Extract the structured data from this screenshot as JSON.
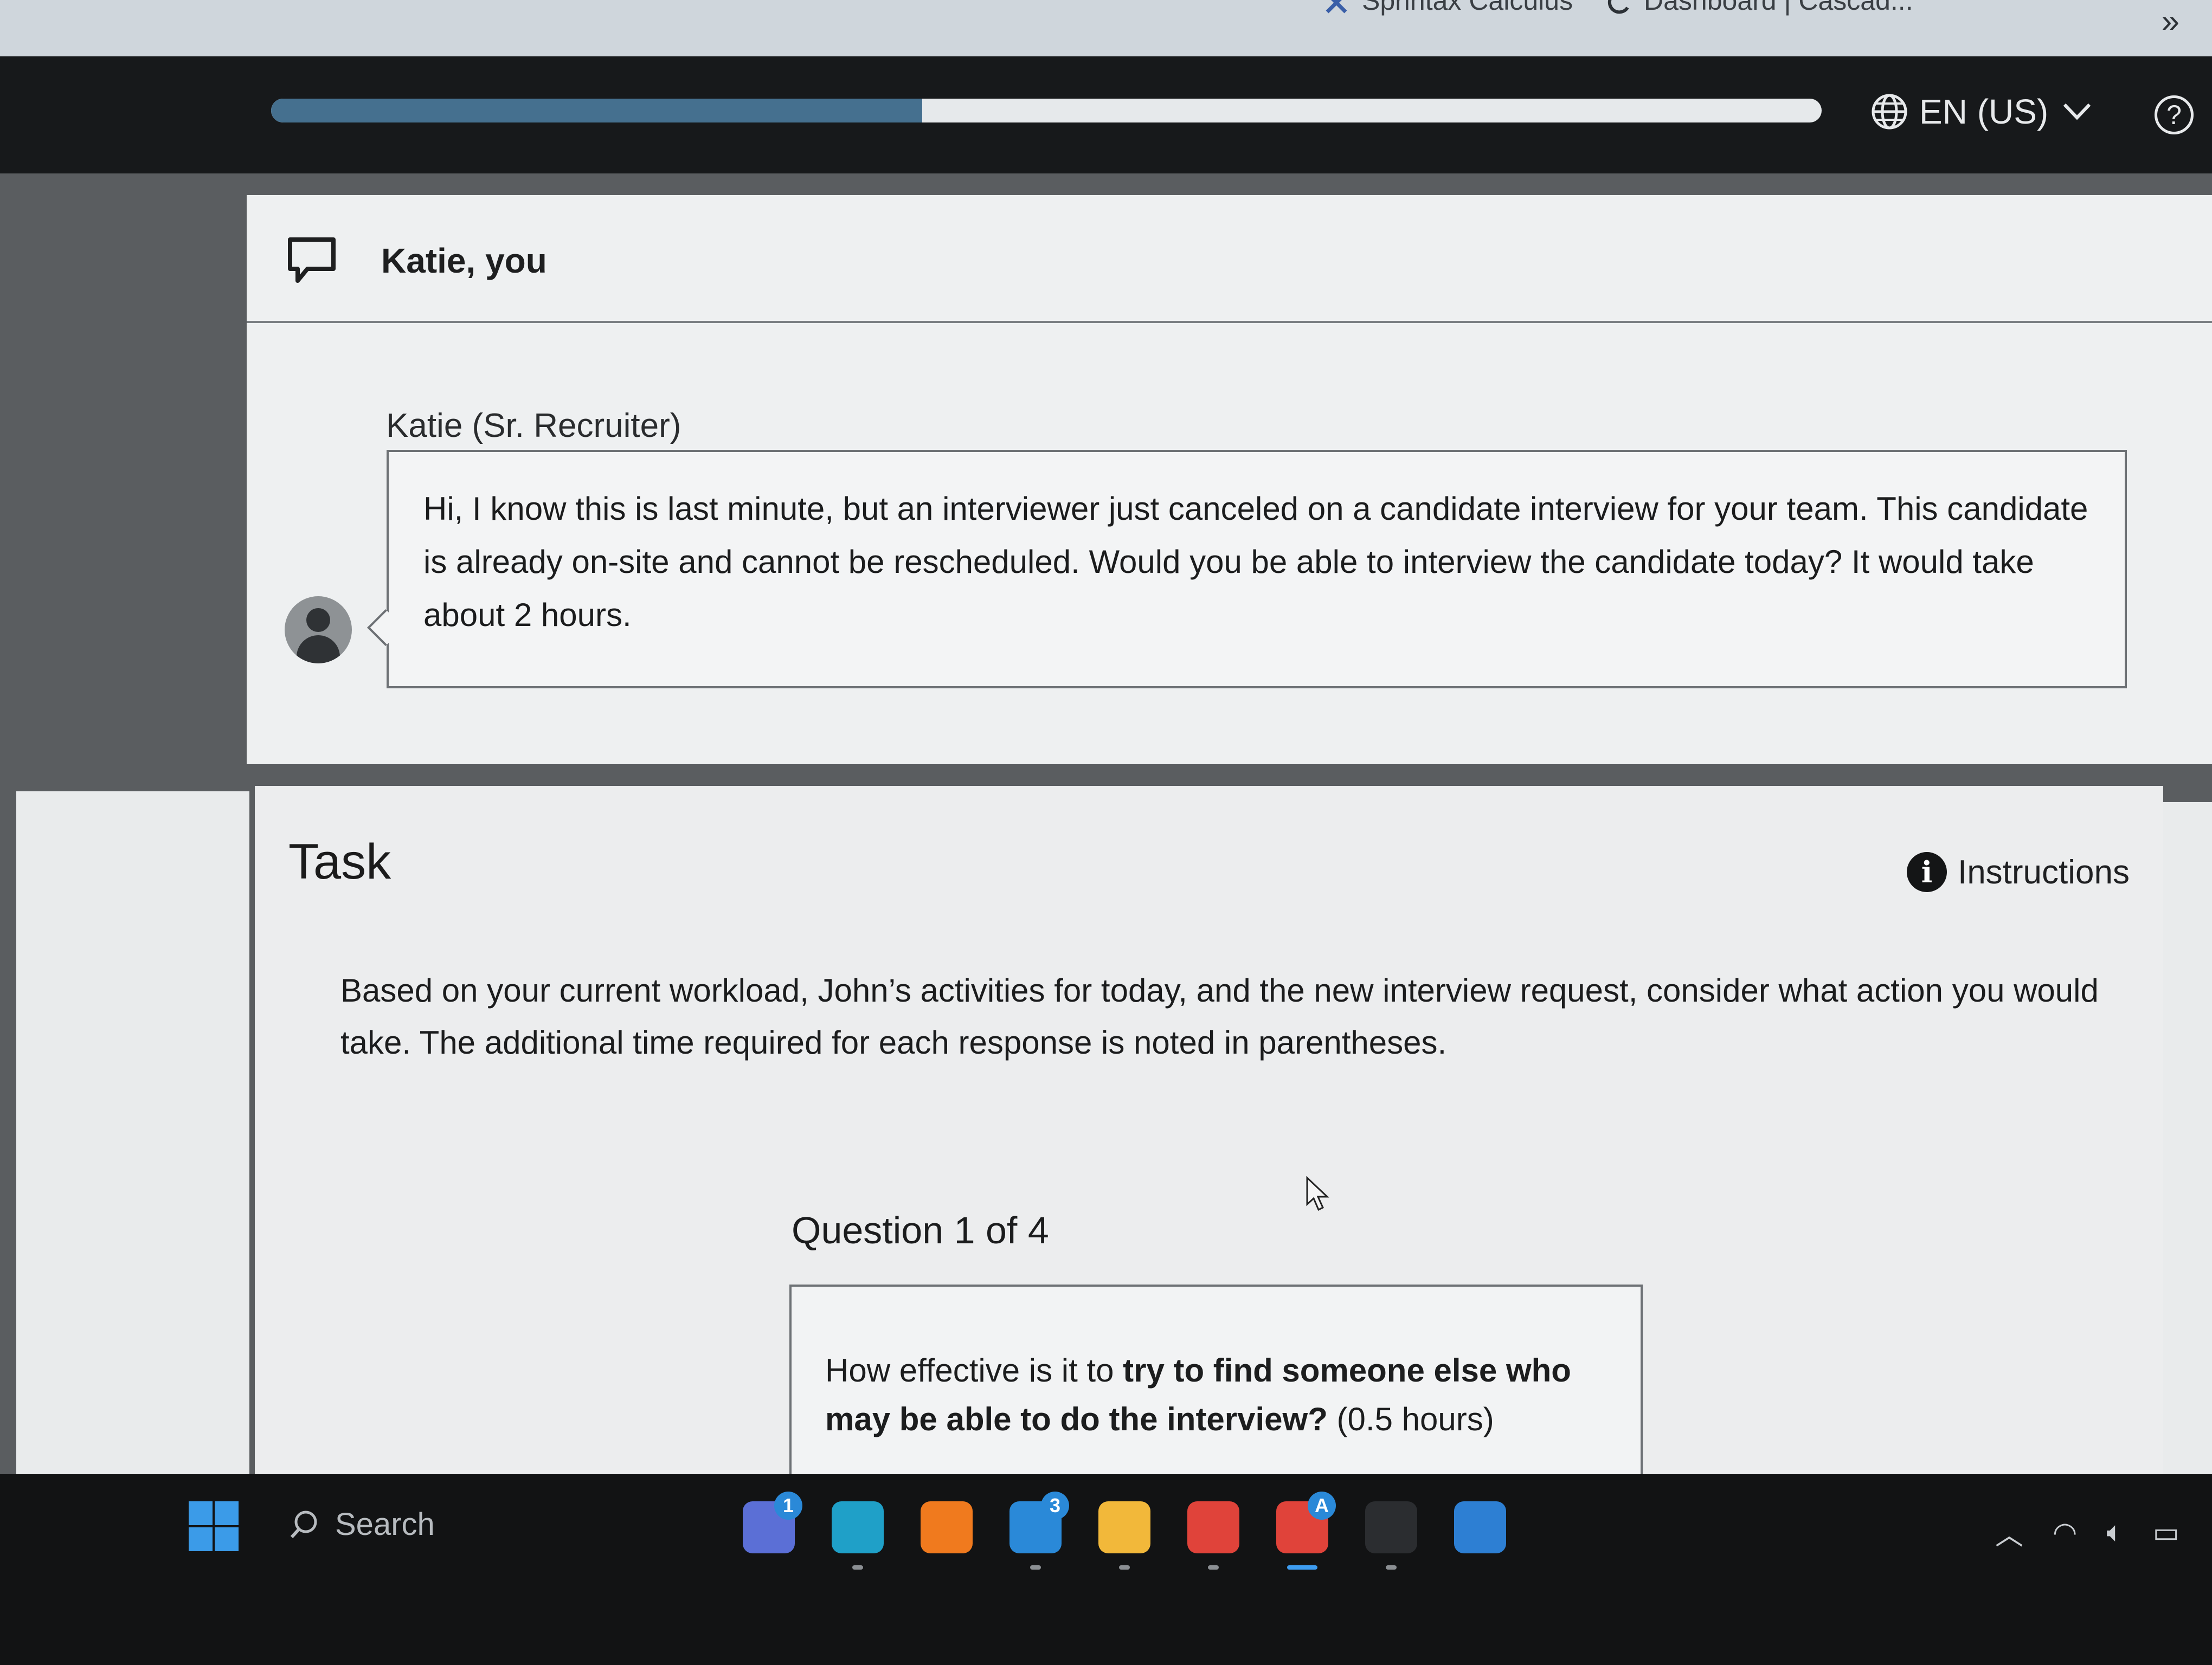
{
  "browser": {
    "tabs": [
      {
        "label": "Sprintax Calculus",
        "icon": "x-logo-icon"
      },
      {
        "label": "Dashboard | Cascad...",
        "icon": "loading-spinner-icon"
      }
    ],
    "more_tabs_icon": "double-chevron-right-icon"
  },
  "header": {
    "progress_fraction": 0.42,
    "language": "EN (US)",
    "help_glyph": "?"
  },
  "chat": {
    "title": "Katie, you",
    "sender": "Katie (Sr. Recruiter)",
    "message": "Hi, I know this is last minute, but an interviewer just canceled on a candidate interview for your team. This candidate is already on-site and cannot be rescheduled. Would you be able to interview the candidate today? It would take about 2 hours."
  },
  "task": {
    "title": "Task",
    "instructions_label": "Instructions",
    "description": "Based on your current workload, John’s activities for today, and the new interview request, consider what action you would take. The additional time required for each response is noted in parentheses.",
    "question_counter": "Question 1 of 4",
    "question": {
      "prefix": "How effective is it to ",
      "bold": "try to find someone else who may be able to do the interview?",
      "suffix": " (0.5 hours)"
    }
  },
  "taskbar": {
    "search_label": "Search",
    "apps": [
      {
        "name": "teams-meet-icon",
        "badge": "1",
        "color": "#5b6fd6"
      },
      {
        "name": "edge-icon",
        "badge": "",
        "color": "#1fa0c8"
      },
      {
        "name": "sublime-text-icon",
        "badge": "",
        "color": "#f07a1e"
      },
      {
        "name": "mail-icon",
        "badge": "3",
        "color": "#2a89d8"
      },
      {
        "name": "file-explorer-icon",
        "badge": "",
        "color": "#f2b83a"
      },
      {
        "name": "chrome-icon",
        "badge": "",
        "color": "#e0433a"
      },
      {
        "name": "chrome-profile-icon",
        "badge": "A",
        "color": "#e0433a"
      },
      {
        "name": "terminal-icon",
        "badge": "",
        "color": "#2b2d30"
      },
      {
        "name": "vscode-icon",
        "badge": "",
        "color": "#2d7fd3"
      }
    ],
    "tray": [
      "chevron-up-icon",
      "wifi-icon",
      "volume-icon",
      "battery-icon"
    ]
  }
}
